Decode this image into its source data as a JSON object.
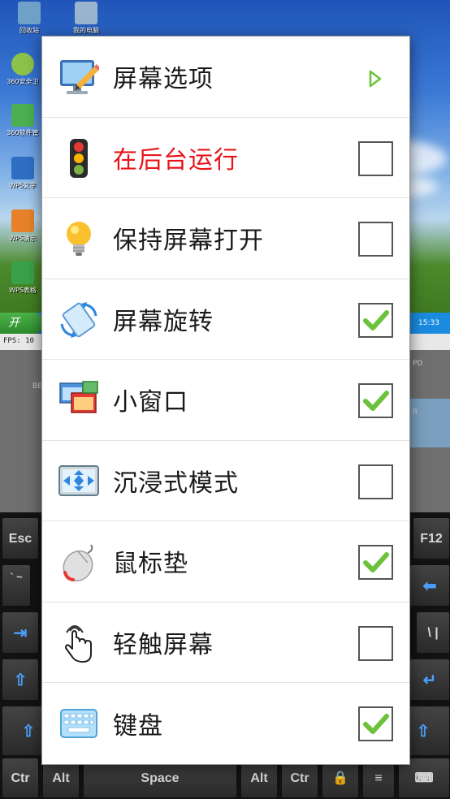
{
  "desktop": {
    "icons": [
      {
        "label": "回收站"
      },
      {
        "label": "我的电脑"
      },
      {
        "label": "360安全卫"
      },
      {
        "label": "360软件管"
      },
      {
        "label": "WPS文字"
      },
      {
        "label": "WPS演示"
      },
      {
        "label": "WPS表格"
      }
    ],
    "start_label": "开",
    "clock": "15:33",
    "status_line": "FPS: 10",
    "left_label": "BE",
    "right_label_1": "PD",
    "right_label_2": "R"
  },
  "keyboard": {
    "esc": "Esc",
    "f12": "F12",
    "tilde": "` ~",
    "backslash": "\\ |",
    "ctrl_left": "Ctr",
    "alt_left": "Alt",
    "space": "Space",
    "alt_right": "Alt",
    "ctrl_right": "Ctr"
  },
  "menu": {
    "items": [
      {
        "label": "屏幕选项",
        "icon": "monitor-pencil-icon",
        "control": "submenu"
      },
      {
        "label": "在后台运行",
        "icon": "traffic-light-icon",
        "control": "checkbox",
        "checked": false,
        "highlight": true
      },
      {
        "label": "保持屏幕打开",
        "icon": "light-bulb-icon",
        "control": "checkbox",
        "checked": false
      },
      {
        "label": "屏幕旋转",
        "icon": "rotate-screen-icon",
        "control": "checkbox",
        "checked": true
      },
      {
        "label": "小窗口",
        "icon": "small-window-icon",
        "control": "checkbox",
        "checked": true
      },
      {
        "label": "沉浸式模式",
        "icon": "fullscreen-icon",
        "control": "checkbox",
        "checked": false
      },
      {
        "label": "鼠标垫",
        "icon": "mouse-icon",
        "control": "checkbox",
        "checked": true
      },
      {
        "label": "轻触屏幕",
        "icon": "touch-hand-icon",
        "control": "checkbox",
        "checked": false
      },
      {
        "label": "键盘",
        "icon": "keyboard-icon",
        "control": "checkbox",
        "checked": true
      }
    ]
  },
  "colors": {
    "highlight_text": "#e8141a",
    "check_green": "#6cc23a",
    "submenu_arrow": "#6cc23a"
  }
}
